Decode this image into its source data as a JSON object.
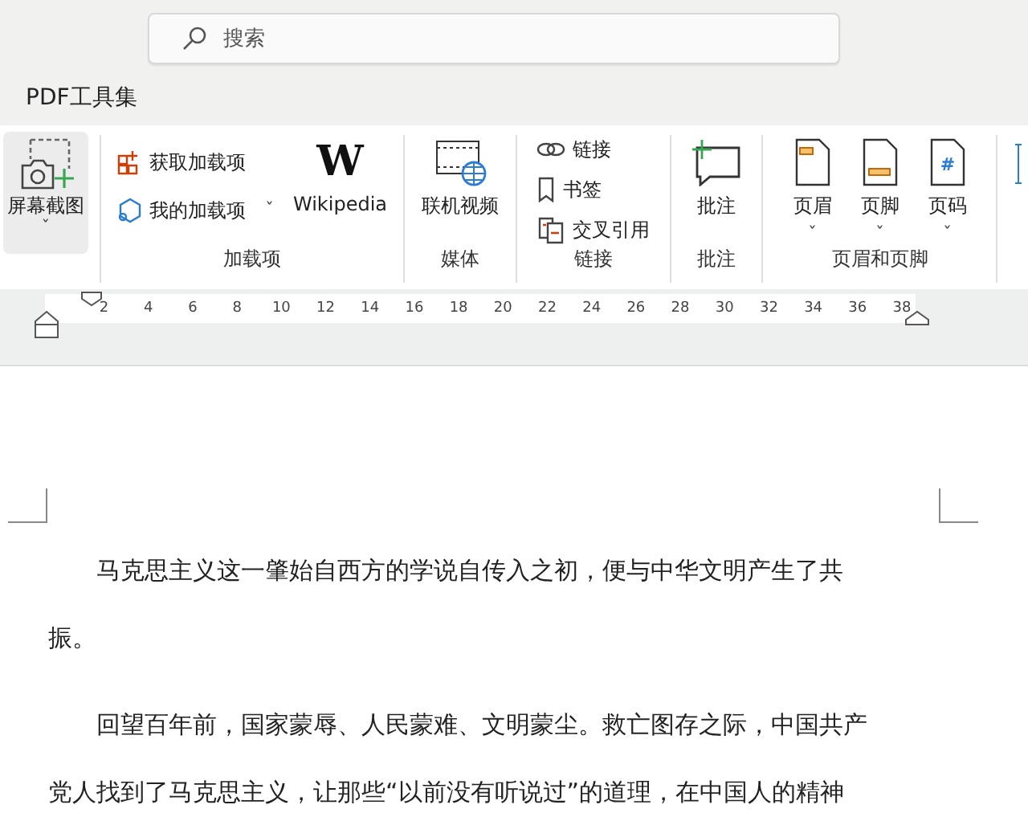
{
  "search": {
    "placeholder": "搜索"
  },
  "menu": {
    "label": "PDF工具集"
  },
  "ribbon": {
    "screenshot": {
      "label": "屏幕截图",
      "caret": "ˇ"
    },
    "groups": [
      {
        "kind": "addins",
        "label": "加载项",
        "items": [
          {
            "label": "获取加载项",
            "kind": "grid"
          },
          {
            "label": "我的加载项",
            "kind": "hex",
            "caret": "ˇ"
          }
        ],
        "big": {
          "label": "Wikipedia",
          "glyph": "W"
        }
      },
      {
        "kind": "big",
        "label": "媒体",
        "items": [
          {
            "label": "联机视频",
            "kind": "video"
          }
        ]
      },
      {
        "kind": "list",
        "label": "链接",
        "items": [
          {
            "label": "链接",
            "kind": "link"
          },
          {
            "label": "书签",
            "kind": "bookmark"
          },
          {
            "label": "交叉引用",
            "kind": "xref"
          }
        ]
      },
      {
        "kind": "big",
        "label": "批注",
        "items": [
          {
            "label": "批注",
            "kind": "comment"
          }
        ]
      },
      {
        "kind": "big",
        "label": "页眉和页脚",
        "items": [
          {
            "label": "页眉",
            "kind": "header",
            "caret": "ˇ"
          },
          {
            "label": "页脚",
            "kind": "footer",
            "caret": "ˇ"
          },
          {
            "label": "页码",
            "kind": "pagenum",
            "caret": "ˇ",
            "glyph": "#"
          }
        ]
      }
    ]
  },
  "ruler": {
    "ticks": [
      "2",
      "4",
      "6",
      "8",
      "10",
      "12",
      "14",
      "16",
      "18",
      "20",
      "22",
      "24",
      "26",
      "28",
      "30",
      "32",
      "34",
      "36",
      "38"
    ]
  },
  "document": {
    "paragraphs": [
      {
        "lines": [
          "马克思主义这一肇始自西方的学说自传入之初，便与中华文明产生了共",
          "振。"
        ]
      },
      {
        "lines": [
          "回望百年前，国家蒙辱、人民蒙难、文明蒙尘。救亡图存之际，中国共产",
          "党人找到了马克思主义，让那些“以前没有听说过”的道理，在中国人的精神"
        ]
      }
    ]
  }
}
